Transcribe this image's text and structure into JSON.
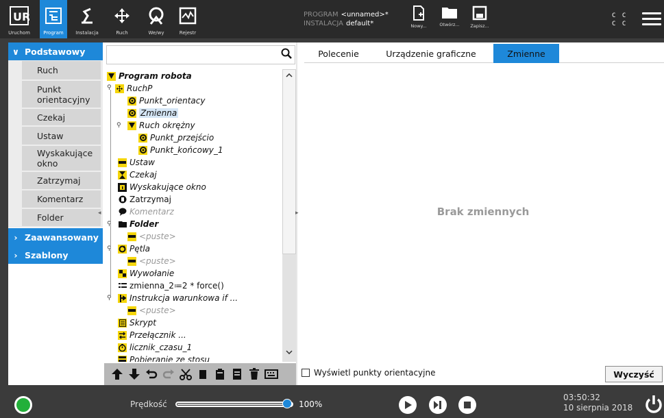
{
  "header": {
    "nav": [
      {
        "label": "Uruchom",
        "icon": "ur-logo-icon"
      },
      {
        "label": "Program",
        "icon": "program-icon",
        "active": true
      },
      {
        "label": "Instalacja",
        "icon": "installation-icon"
      },
      {
        "label": "Ruch",
        "icon": "move-icon"
      },
      {
        "label": "We/wy",
        "icon": "io-icon"
      },
      {
        "label": "Rejestr",
        "icon": "log-icon"
      }
    ],
    "program_key": "PROGRAM",
    "program_value": "<unnamed>*",
    "installation_key": "INSTALACJA",
    "installation_value": "default*",
    "file_buttons": [
      {
        "label": "Nowy...",
        "icon": "new-file-icon"
      },
      {
        "label": "Otwórz...",
        "icon": "open-folder-icon"
      },
      {
        "label": "Zapisz...",
        "icon": "save-icon"
      }
    ],
    "cc_line1": "C C",
    "cc_line2": "C C"
  },
  "left": {
    "categories": {
      "basic": "Podstawowy",
      "advanced": "Zaawansowany",
      "templates": "Szablony"
    },
    "basic_items": [
      "Ruch",
      "Punkt orientacyjny",
      "Czekaj",
      "Ustaw",
      "Wyskakujące okno",
      "Zatrzymaj",
      "Komentarz",
      "Folder"
    ]
  },
  "search": {
    "placeholder": ""
  },
  "tree": {
    "root": "Program robota",
    "nodes": [
      "RuchP",
      "Punkt_orientacy",
      "Zmienna",
      "Ruch okrężny",
      "Punkt_przejścio",
      "Punkt_końcowy_1",
      "Ustaw",
      "Czekaj",
      "Wyskakujące okno",
      "Zatrzymaj",
      "Komentarz",
      "Folder",
      "<puste>",
      "Pętla",
      "<puste>",
      "Wywołanie",
      "zmienna_2≔2 * force()",
      "Instrukcja warunkowa if ...",
      "<puste>",
      "Skrypt",
      "Przełącznik ...",
      "licznik_czasu_1",
      "Pobieranie ze stosu"
    ]
  },
  "tabs": [
    "Polecenie",
    "Urządzenie graficzne",
    "Zmienne"
  ],
  "active_tab": "Zmienne",
  "variables": {
    "empty_message": "Brak zmiennych"
  },
  "show_waypoints_label": "Wyświetl punkty orientacyjne",
  "clear_button": "Wyczyść",
  "footer": {
    "speed_label": "Prędkość",
    "speed_value": "100%",
    "speed_fraction": 1.0,
    "time": "03:50:32",
    "date": "10 sierpnia 2018"
  },
  "colors": {
    "accent": "#1e88d9",
    "header_bg": "#2a2a2a",
    "footer_bg": "#3b3b3b",
    "node_yellow": "#f5d60a",
    "status_green": "#23b03a"
  }
}
